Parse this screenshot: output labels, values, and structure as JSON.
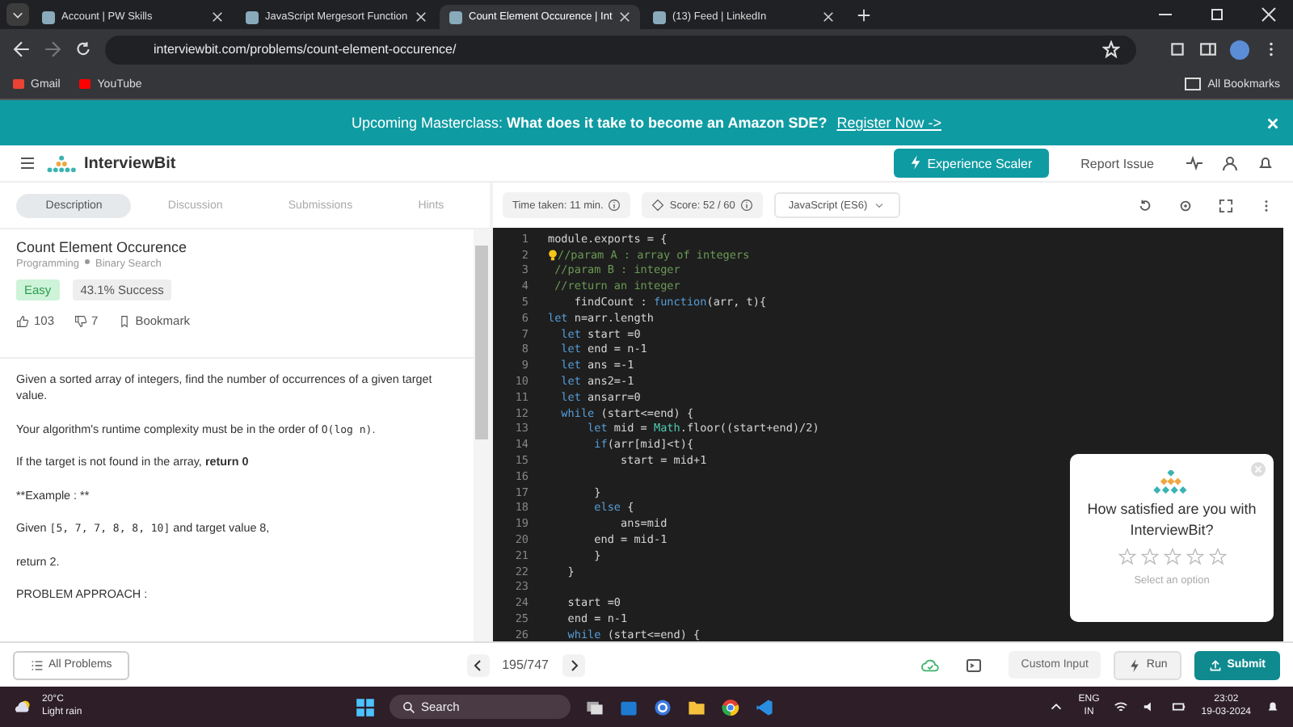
{
  "browser": {
    "tabs": [
      {
        "title": "Account | PW Skills",
        "selected": false
      },
      {
        "title": "JavaScript Mergesort Function",
        "selected": false
      },
      {
        "title": "Count Element Occurence | Int",
        "selected": true
      },
      {
        "title": "(13) Feed | LinkedIn",
        "selected": false
      }
    ],
    "url": "interviewbit.com/problems/count-element-occurence/",
    "bookmarks": [
      "Gmail",
      "YouTube"
    ],
    "all_bookmarks": "All Bookmarks"
  },
  "banner": {
    "prefix": "Upcoming Masterclass:",
    "headline": "What does it take to become an Amazon SDE?",
    "link": "Register Now ->"
  },
  "header": {
    "logo": "InterviewBit",
    "cta": "Experience Scaler",
    "report": "Report Issue"
  },
  "problem_tabs": [
    {
      "label": "Description",
      "selected": true
    },
    {
      "label": "Discussion",
      "selected": false
    },
    {
      "label": "Submissions",
      "selected": false
    },
    {
      "label": "Hints",
      "selected": false
    }
  ],
  "problem": {
    "title": "Count Element Occurence",
    "topic": "Programming",
    "subtopic": "Binary Search",
    "difficulty": "Easy",
    "success": "43.1% Success",
    "likes": "103",
    "dislikes": "7",
    "bookmark": "Bookmark",
    "description": [
      [
        {
          "text": "Given a sorted array of integers, find the number of occurrences of a given target value.",
          "kind": "text"
        }
      ],
      [
        {
          "text": "Your algorithm's runtime complexity must be in the order of ",
          "kind": "text"
        },
        {
          "text": "O(log n)",
          "kind": "code"
        },
        {
          "text": ".",
          "kind": "text"
        }
      ],
      [
        {
          "text": "If the target is not found in the array, **return 0**",
          "kind": "text"
        }
      ],
      [
        {
          "text": "**Example : **",
          "kind": "text"
        }
      ],
      [
        {
          "text": "Given ",
          "kind": "text"
        },
        {
          "text": "[5, 7, 7, 8, 8, 10]",
          "kind": "code"
        },
        {
          "text": " and target value 8,",
          "kind": "text"
        }
      ],
      [
        {
          "text": "return 2.",
          "kind": "text"
        }
      ],
      [
        {
          "text": "PROBLEM APPROACH :",
          "kind": "text"
        }
      ]
    ]
  },
  "editor": {
    "time": "Time taken: 11 min.",
    "score": "Score: 52 / 60",
    "language": "JavaScript (ES6)",
    "lines": [
      {
        "n": "1",
        "parts": [
          {
            "t": "module.exports = {",
            "kind": "plain"
          }
        ]
      },
      {
        "n": "2",
        "bulb": true,
        "parts": [
          {
            "t": "//param A : array of integers",
            "kind": "comment"
          }
        ]
      },
      {
        "n": "3",
        "parts": [
          {
            "t": " //param B : integer",
            "kind": "comment"
          }
        ]
      },
      {
        "n": "4",
        "parts": [
          {
            "t": " //return an integer",
            "kind": "comment"
          }
        ]
      },
      {
        "n": "5",
        "parts": [
          {
            "t": "    findCount : ",
            "kind": "plain"
          },
          {
            "t": "function",
            "kind": "keyword"
          },
          {
            "t": "(arr, t){",
            "kind": "plain"
          }
        ]
      },
      {
        "n": "6",
        "parts": [
          {
            "t": "let",
            "kind": "keyword"
          },
          {
            "t": " n=arr.length",
            "kind": "plain"
          }
        ]
      },
      {
        "n": "7",
        "parts": [
          {
            "t": "  let",
            "kind": "keyword"
          },
          {
            "t": " start =0",
            "kind": "plain"
          }
        ]
      },
      {
        "n": "8",
        "parts": [
          {
            "t": "  let",
            "kind": "keyword"
          },
          {
            "t": " end = n-1",
            "kind": "plain"
          }
        ]
      },
      {
        "n": "9",
        "parts": [
          {
            "t": "  let",
            "kind": "keyword"
          },
          {
            "t": " ans =-1",
            "kind": "plain"
          }
        ]
      },
      {
        "n": "10",
        "parts": [
          {
            "t": "  let",
            "kind": "keyword"
          },
          {
            "t": " ans2=-1",
            "kind": "plain"
          }
        ]
      },
      {
        "n": "11",
        "parts": [
          {
            "t": "  let",
            "kind": "keyword"
          },
          {
            "t": " ansarr=0",
            "kind": "plain"
          }
        ]
      },
      {
        "n": "12",
        "parts": [
          {
            "t": "  while",
            "kind": "keyword"
          },
          {
            "t": " (start<=end) {",
            "kind": "plain"
          }
        ]
      },
      {
        "n": "13",
        "parts": [
          {
            "t": "      let",
            "kind": "keyword"
          },
          {
            "t": " mid = ",
            "kind": "plain"
          },
          {
            "t": "Math",
            "kind": "builtin"
          },
          {
            "t": ".floor((start+end)/2)",
            "kind": "plain"
          }
        ]
      },
      {
        "n": "14",
        "parts": [
          {
            "t": "       if",
            "kind": "keyword"
          },
          {
            "t": "(arr[mid]<t){",
            "kind": "plain"
          }
        ]
      },
      {
        "n": "15",
        "parts": [
          {
            "t": "           start = mid+1",
            "kind": "plain"
          }
        ]
      },
      {
        "n": "16"
      },
      {
        "n": "17",
        "parts": [
          {
            "t": "       }",
            "kind": "plain"
          }
        ]
      },
      {
        "n": "18",
        "parts": [
          {
            "t": "       else",
            "kind": "keyword"
          },
          {
            "t": " {",
            "kind": "plain"
          }
        ]
      },
      {
        "n": "19",
        "parts": [
          {
            "t": "           ans=mid",
            "kind": "plain"
          }
        ]
      },
      {
        "n": "20",
        "parts": [
          {
            "t": "       end = mid-1",
            "kind": "plain"
          }
        ]
      },
      {
        "n": "21",
        "parts": [
          {
            "t": "       }",
            "kind": "plain"
          }
        ]
      },
      {
        "n": "22",
        "parts": [
          {
            "t": "   }",
            "kind": "plain"
          }
        ]
      },
      {
        "n": "23"
      },
      {
        "n": "24",
        "parts": [
          {
            "t": "   start =0",
            "kind": "plain"
          }
        ]
      },
      {
        "n": "25",
        "parts": [
          {
            "t": "   end = n-1",
            "kind": "plain"
          }
        ]
      },
      {
        "n": "26",
        "parts": [
          {
            "t": "   while",
            "kind": "keyword"
          },
          {
            "t": " (start<=end) {",
            "kind": "plain"
          }
        ]
      }
    ]
  },
  "survey": {
    "question": "How satisfied are you with InterviewBit?",
    "stars": 0,
    "hint": "Select an option"
  },
  "footer": {
    "all_problems": "All Problems",
    "pager": "195/747",
    "custom_input": "Custom Input",
    "run": "Run",
    "submit": "Submit"
  },
  "taskbar": {
    "temperature": "20°C",
    "weather": "Light rain",
    "search": "Search",
    "lang": "ENG",
    "region": "IN",
    "time": "23:02",
    "date": "19-03-2024"
  }
}
